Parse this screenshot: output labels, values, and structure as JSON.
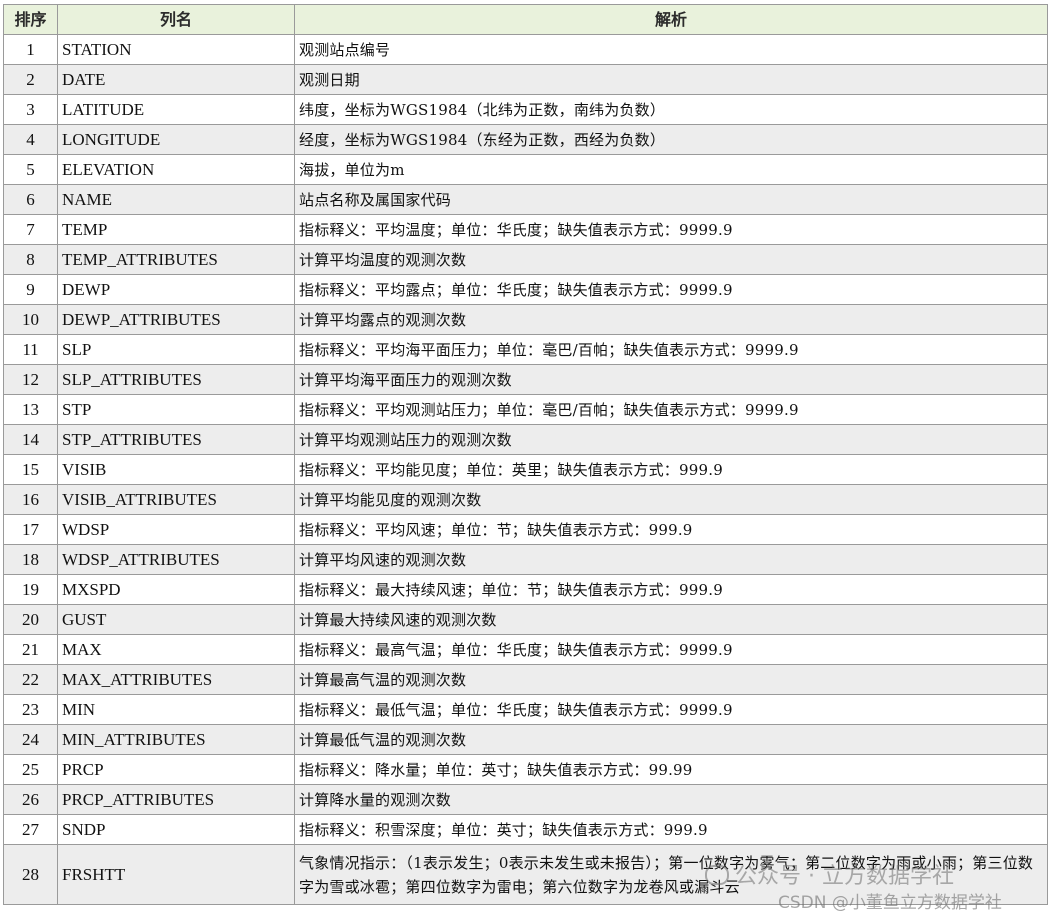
{
  "table": {
    "headers": [
      "排序",
      "列名",
      "解析"
    ],
    "rows": [
      {
        "no": "1",
        "name": "STATION",
        "desc": "观测站点编号"
      },
      {
        "no": "2",
        "name": "DATE",
        "desc": "观测日期"
      },
      {
        "no": "3",
        "name": "LATITUDE",
        "desc": "纬度，坐标为WGS1984（北纬为正数，南纬为负数）"
      },
      {
        "no": "4",
        "name": "LONGITUDE",
        "desc": "经度，坐标为WGS1984（东经为正数，西经为负数）"
      },
      {
        "no": "5",
        "name": "ELEVATION",
        "desc": "海拔，单位为m"
      },
      {
        "no": "6",
        "name": "NAME",
        "desc": "站点名称及属国家代码"
      },
      {
        "no": "7",
        "name": "TEMP",
        "desc": "指标释义：平均温度；单位：华氏度；缺失值表示方式：9999.9"
      },
      {
        "no": "8",
        "name": "TEMP_ATTRIBUTES",
        "desc": "计算平均温度的观测次数"
      },
      {
        "no": "9",
        "name": "DEWP",
        "desc": "指标释义：平均露点；单位：华氏度；缺失值表示方式：9999.9"
      },
      {
        "no": "10",
        "name": "DEWP_ATTRIBUTES",
        "desc": "计算平均露点的观测次数"
      },
      {
        "no": "11",
        "name": "SLP",
        "desc": "指标释义：平均海平面压力；单位：毫巴/百帕；缺失值表示方式：9999.9"
      },
      {
        "no": "12",
        "name": "SLP_ATTRIBUTES",
        "desc": "计算平均海平面压力的观测次数"
      },
      {
        "no": "13",
        "name": "STP",
        "desc": "指标释义：平均观测站压力；单位：毫巴/百帕；缺失值表示方式：9999.9"
      },
      {
        "no": "14",
        "name": "STP_ATTRIBUTES",
        "desc": "计算平均观测站压力的观测次数"
      },
      {
        "no": "15",
        "name": "VISIB",
        "desc": "指标释义：平均能见度；单位：英里；缺失值表示方式：999.9"
      },
      {
        "no": "16",
        "name": "VISIB_ATTRIBUTES",
        "desc": "计算平均能见度的观测次数"
      },
      {
        "no": "17",
        "name": "WDSP",
        "desc": "指标释义：平均风速；单位：节；缺失值表示方式：999.9"
      },
      {
        "no": "18",
        "name": "WDSP_ATTRIBUTES",
        "desc": "计算平均风速的观测次数"
      },
      {
        "no": "19",
        "name": "MXSPD",
        "desc": "指标释义：最大持续风速；单位：节；缺失值表示方式：999.9"
      },
      {
        "no": "20",
        "name": "GUST",
        "desc": "计算最大持续风速的观测次数"
      },
      {
        "no": "21",
        "name": "MAX",
        "desc": "指标释义：最高气温；单位：华氏度；缺失值表示方式：9999.9"
      },
      {
        "no": "22",
        "name": "MAX_ATTRIBUTES",
        "desc": "计算最高气温的观测次数"
      },
      {
        "no": "23",
        "name": "MIN",
        "desc": "指标释义：最低气温；单位：华氏度；缺失值表示方式：9999.9"
      },
      {
        "no": "24",
        "name": "MIN_ATTRIBUTES",
        "desc": "计算最低气温的观测次数"
      },
      {
        "no": "25",
        "name": "PRCP",
        "desc": "指标释义：降水量；单位：英寸；缺失值表示方式：99.99"
      },
      {
        "no": "26",
        "name": "PRCP_ATTRIBUTES",
        "desc": "计算降水量的观测次数"
      },
      {
        "no": "27",
        "name": "SNDP",
        "desc": "指标释义：积雪深度；单位：英寸；缺失值表示方式：999.9"
      },
      {
        "no": "28",
        "name": "FRSHTT",
        "desc": "气象情况指示：（1表示发生；0表示未发生或未报告）；第一位数字为雾气；第二位数字为雨或小雨；第三位数字为雪或冰雹；第四位数字为雷电；第六位数字为龙卷风或漏斗云"
      }
    ]
  },
  "watermark": {
    "text": "公众号 · 立方数据学社",
    "source": "CSDN @小董鱼立方数据学社"
  }
}
